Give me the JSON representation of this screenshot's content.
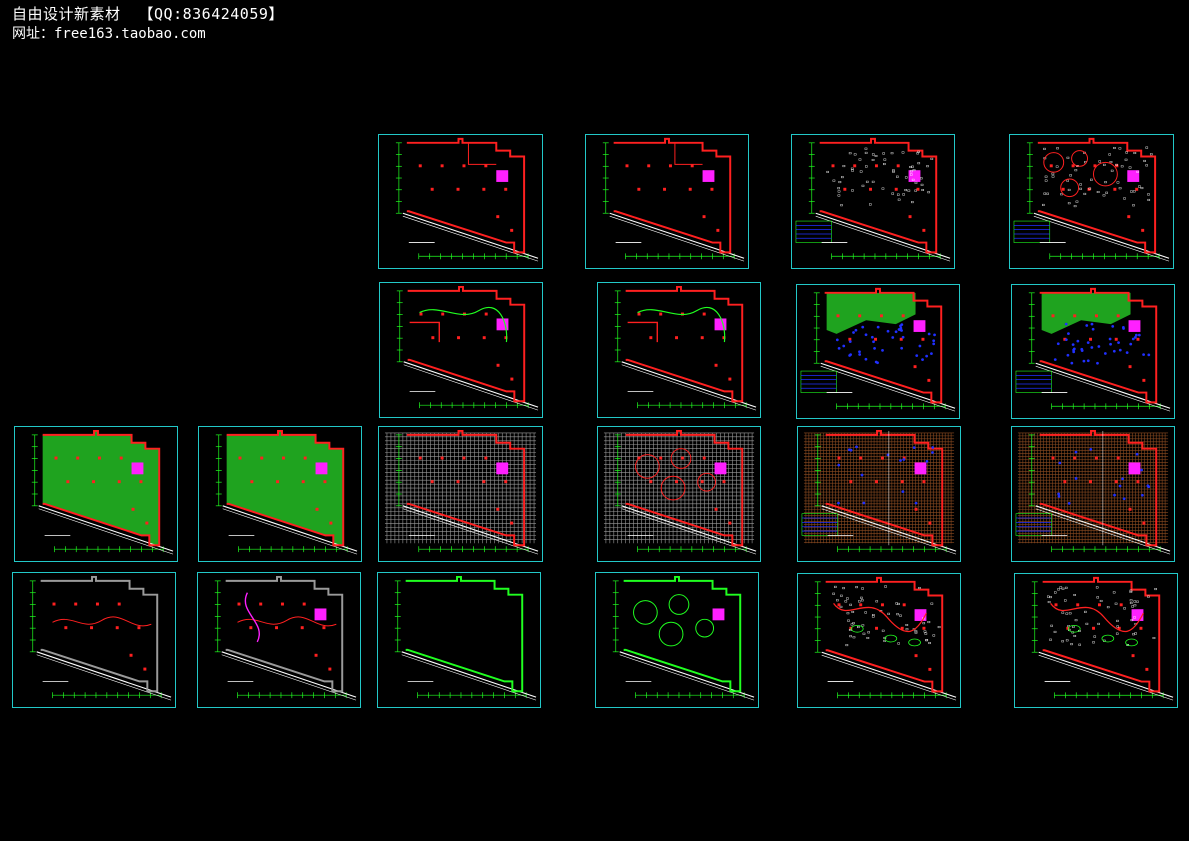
{
  "header": {
    "title": "自由设计新素材",
    "qq": "【QQ:836424059】",
    "website_label": "网址：",
    "website": "free163.taobao.com"
  },
  "colors": {
    "background": "#000000",
    "frame": "#22c8c8",
    "wall": "#ff2020",
    "line": "#20ff20",
    "fill_green": "#1fa31f",
    "magenta": "#ff20ff",
    "blue": "#2030ff",
    "grid_gray": "#9a9a9a",
    "brown": "#8a4a20"
  },
  "drawings": [
    {
      "id": "r1c1",
      "variant": "plain"
    },
    {
      "id": "r1c2",
      "variant": "plain"
    },
    {
      "id": "r1c3",
      "variant": "furniture",
      "legend": true
    },
    {
      "id": "r1c4",
      "variant": "furniture-circles",
      "legend": true
    },
    {
      "id": "r2c1",
      "variant": "walls"
    },
    {
      "id": "r2c2",
      "variant": "walls"
    },
    {
      "id": "r2c3",
      "variant": "blue-dots",
      "legend": true
    },
    {
      "id": "r2c4",
      "variant": "blue-dots",
      "legend": true
    },
    {
      "id": "r3c1",
      "variant": "green-fill"
    },
    {
      "id": "r3c2",
      "variant": "green-fill"
    },
    {
      "id": "r3c3",
      "variant": "grid-gray"
    },
    {
      "id": "r3c4",
      "variant": "grid-gray-curves"
    },
    {
      "id": "r3c5",
      "variant": "grid-brown",
      "legend": true
    },
    {
      "id": "r3c6",
      "variant": "grid-brown",
      "legend": true
    },
    {
      "id": "r4c1",
      "variant": "gray-outline"
    },
    {
      "id": "r4c2",
      "variant": "gray-magenta"
    },
    {
      "id": "r4c3",
      "variant": "green-outline"
    },
    {
      "id": "r4c4",
      "variant": "green-outline-circles"
    },
    {
      "id": "r4c5",
      "variant": "red-fixtures"
    },
    {
      "id": "r4c6",
      "variant": "red-fixtures"
    }
  ]
}
